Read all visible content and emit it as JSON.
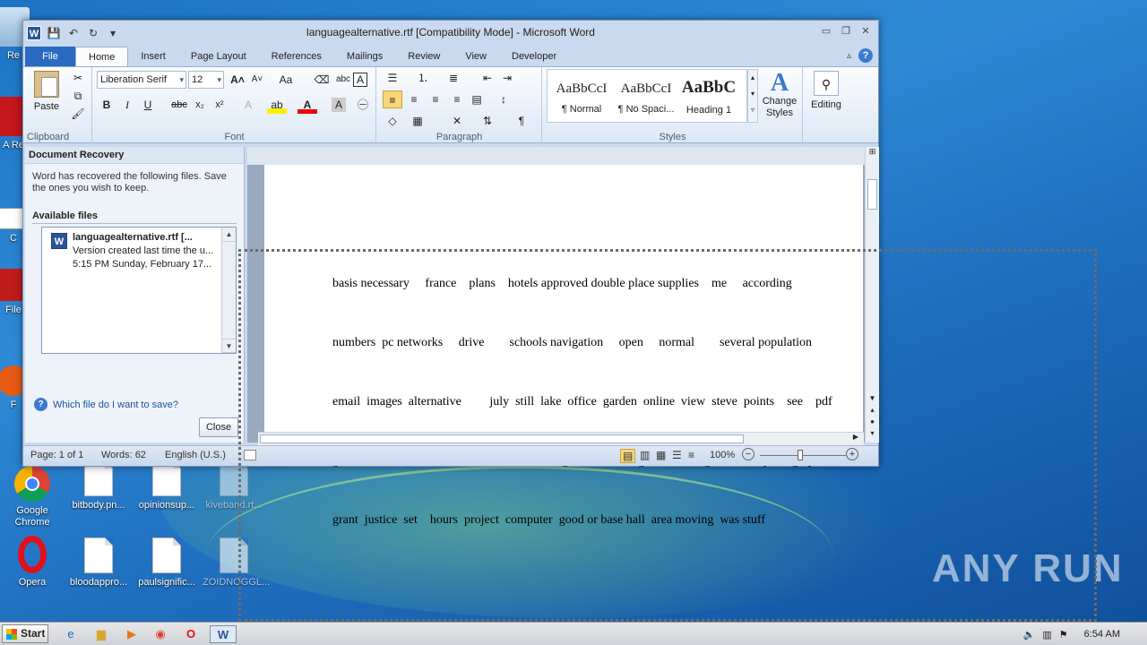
{
  "desktop": {
    "icons": [
      {
        "label": "Re"
      },
      {
        "label": "A Re"
      },
      {
        "label": "C"
      },
      {
        "label": "File"
      },
      {
        "label": "F"
      },
      {
        "label": "Google Chrome"
      },
      {
        "label": "bitbody.pn..."
      },
      {
        "label": "opinionsup..."
      },
      {
        "label": "kiveband.rt..."
      },
      {
        "label": "Opera"
      },
      {
        "label": "bloodappro..."
      },
      {
        "label": "paulsignific..."
      },
      {
        "label": "ZOIDNOGGL..."
      }
    ],
    "watermark": "ANY RUN"
  },
  "window": {
    "title": "languagealternative.rtf [Compatibility Mode]  -  Microsoft Word",
    "tabs": [
      "File",
      "Home",
      "Insert",
      "Page Layout",
      "References",
      "Mailings",
      "Review",
      "View",
      "Developer"
    ],
    "active_tab": "Home"
  },
  "ribbon": {
    "clipboard": {
      "paste": "Paste",
      "label": "Clipboard"
    },
    "font": {
      "name": "Liberation Serif",
      "size": "12",
      "label": "Font"
    },
    "paragraph": {
      "label": "Paragraph"
    },
    "styles": {
      "items": [
        {
          "sample": "AaBbCcI",
          "name": "¶ Normal"
        },
        {
          "sample": "AaBbCcI",
          "name": "¶ No Spaci..."
        },
        {
          "sample": "AaBbC",
          "name": "Heading 1"
        }
      ],
      "change": "Change Styles",
      "label": "Styles"
    },
    "editing": {
      "label": "Editing"
    }
  },
  "recovery": {
    "header": "Document Recovery",
    "message": "Word has recovered the following files.  Save the ones you wish to keep.",
    "available": "Available files",
    "file": {
      "name": "languagealternative.rtf  [...",
      "desc": "Version created last time the u...",
      "time": "5:15 PM Sunday, February 17..."
    },
    "help_link": "Which file do I want to save?",
    "close": "Close"
  },
  "document": {
    "lines": [
      "basis necessary     france    plans    hotels approved double place supplies    me     according",
      "numbers  pc networks     drive        schools navigation     open     normal        several population",
      "email  images  alternative         july  still  lake  office  garden  online  view  steve  points    see    pdf",
      "government  few  while  him     without      england       mr    games message  african  photograph",
      "grant  justice  set    hours  project  computer  good or base hall  area moving  was stuff"
    ]
  },
  "status": {
    "page": "Page: 1 of 1",
    "words": "Words: 62",
    "language": "English (U.S.)",
    "zoom": "100%"
  },
  "taskbar": {
    "start": "Start",
    "time": "6:54 AM"
  }
}
